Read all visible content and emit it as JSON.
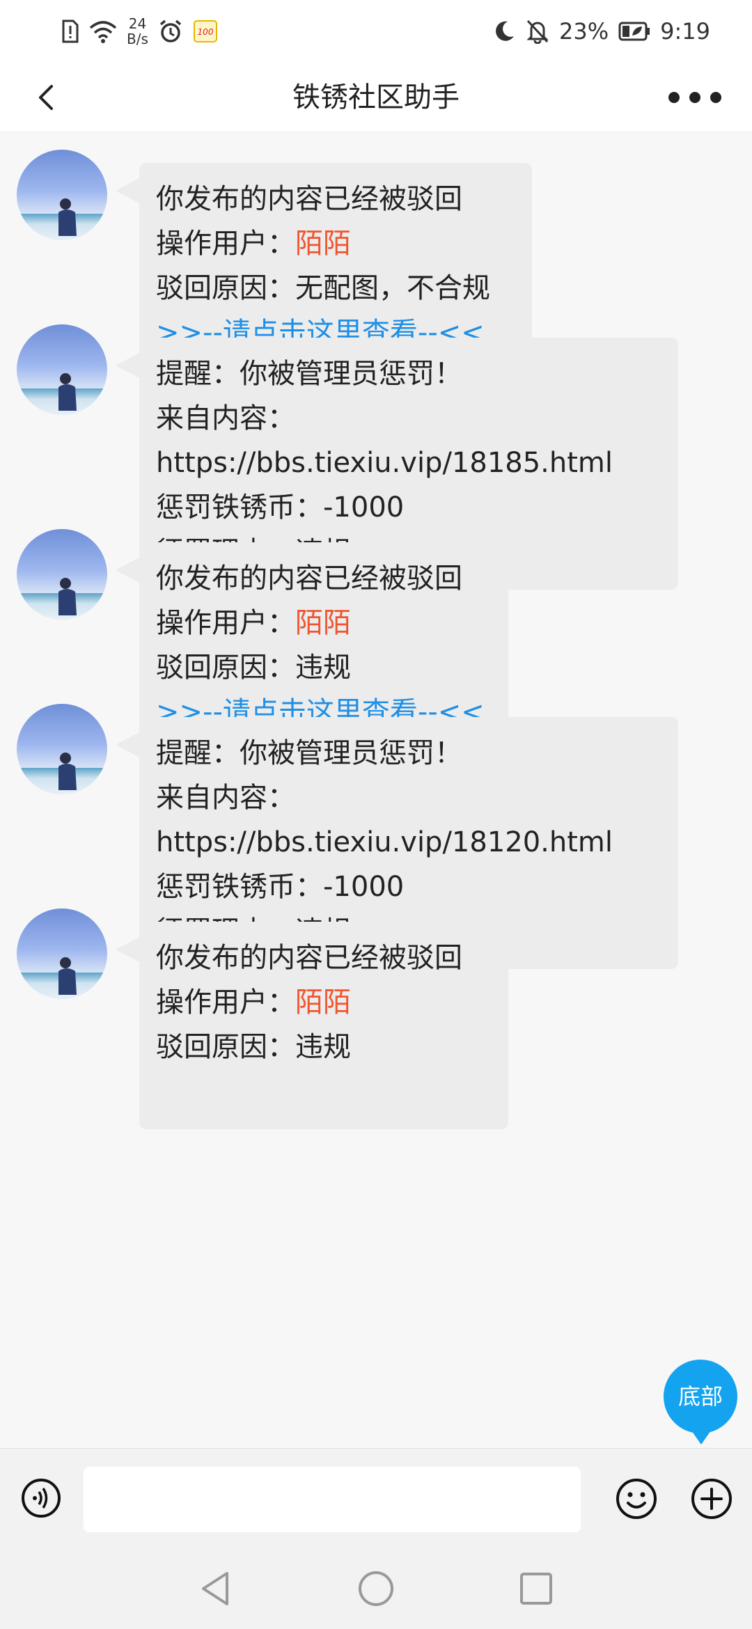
{
  "status_bar": {
    "net_speed_value": "24",
    "net_speed_unit": "B/s",
    "battery_percent": "23%",
    "time": "9:19"
  },
  "header": {
    "title": "铁锈社区助手"
  },
  "messages": [
    {
      "lines": {
        "title": "你发布的内容已经被驳回",
        "operator_label": "操作用户：",
        "operator_name": "陌陌",
        "reason": "驳回原因：无配图，不合规",
        "link": ">>--请点击这里查看--<<"
      }
    },
    {
      "lines": {
        "title": "提醒：你被管理员惩罚！",
        "source_label": "来自内容：",
        "source_url": "https://bbs.tiexiu.vip/18185.html",
        "penalty": "惩罚铁锈币：-1000",
        "reason": "惩罚理由：违规"
      }
    },
    {
      "lines": {
        "title": "你发布的内容已经被驳回",
        "operator_label": "操作用户：",
        "operator_name": "陌陌",
        "reason": "驳回原因：违规",
        "link": ">>--请点击这里查看--<<"
      }
    },
    {
      "lines": {
        "title": "提醒：你被管理员惩罚！",
        "source_label": "来自内容：",
        "source_url": "https://bbs.tiexiu.vip/18120.html",
        "penalty": "惩罚铁锈币：-1000",
        "reason": "惩罚理由：违规"
      }
    },
    {
      "lines": {
        "title": "你发布的内容已经被驳回",
        "operator_label": "操作用户：",
        "operator_name": "陌陌",
        "reason": "驳回原因：违规"
      }
    }
  ],
  "float_button": {
    "label": "底部"
  },
  "input_bar": {
    "placeholder": ""
  },
  "colors": {
    "operator_name": "#f0552f",
    "link": "#1e8fe6",
    "float_button": "#14a3ee",
    "bubble": "#ececec"
  },
  "icons": [
    "back-arrow-icon",
    "more-dots-icon",
    "voice-icon",
    "emoji-icon",
    "plus-icon",
    "nav-back-icon",
    "nav-home-icon",
    "nav-recent-icon"
  ]
}
